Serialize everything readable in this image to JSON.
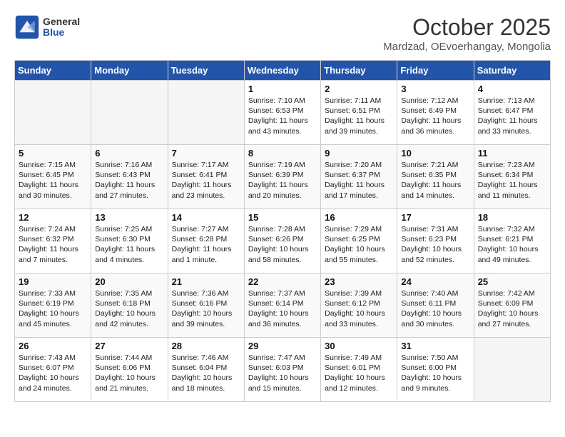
{
  "header": {
    "logo_general": "General",
    "logo_blue": "Blue",
    "month": "October 2025",
    "location": "Mardzad, OEvoerhangay, Mongolia"
  },
  "weekdays": [
    "Sunday",
    "Monday",
    "Tuesday",
    "Wednesday",
    "Thursday",
    "Friday",
    "Saturday"
  ],
  "weeks": [
    [
      {
        "day": "",
        "info": ""
      },
      {
        "day": "",
        "info": ""
      },
      {
        "day": "",
        "info": ""
      },
      {
        "day": "1",
        "info": "Sunrise: 7:10 AM\nSunset: 6:53 PM\nDaylight: 11 hours and 43 minutes."
      },
      {
        "day": "2",
        "info": "Sunrise: 7:11 AM\nSunset: 6:51 PM\nDaylight: 11 hours and 39 minutes."
      },
      {
        "day": "3",
        "info": "Sunrise: 7:12 AM\nSunset: 6:49 PM\nDaylight: 11 hours and 36 minutes."
      },
      {
        "day": "4",
        "info": "Sunrise: 7:13 AM\nSunset: 6:47 PM\nDaylight: 11 hours and 33 minutes."
      }
    ],
    [
      {
        "day": "5",
        "info": "Sunrise: 7:15 AM\nSunset: 6:45 PM\nDaylight: 11 hours and 30 minutes."
      },
      {
        "day": "6",
        "info": "Sunrise: 7:16 AM\nSunset: 6:43 PM\nDaylight: 11 hours and 27 minutes."
      },
      {
        "day": "7",
        "info": "Sunrise: 7:17 AM\nSunset: 6:41 PM\nDaylight: 11 hours and 23 minutes."
      },
      {
        "day": "8",
        "info": "Sunrise: 7:19 AM\nSunset: 6:39 PM\nDaylight: 11 hours and 20 minutes."
      },
      {
        "day": "9",
        "info": "Sunrise: 7:20 AM\nSunset: 6:37 PM\nDaylight: 11 hours and 17 minutes."
      },
      {
        "day": "10",
        "info": "Sunrise: 7:21 AM\nSunset: 6:35 PM\nDaylight: 11 hours and 14 minutes."
      },
      {
        "day": "11",
        "info": "Sunrise: 7:23 AM\nSunset: 6:34 PM\nDaylight: 11 hours and 11 minutes."
      }
    ],
    [
      {
        "day": "12",
        "info": "Sunrise: 7:24 AM\nSunset: 6:32 PM\nDaylight: 11 hours and 7 minutes."
      },
      {
        "day": "13",
        "info": "Sunrise: 7:25 AM\nSunset: 6:30 PM\nDaylight: 11 hours and 4 minutes."
      },
      {
        "day": "14",
        "info": "Sunrise: 7:27 AM\nSunset: 6:28 PM\nDaylight: 11 hours and 1 minute."
      },
      {
        "day": "15",
        "info": "Sunrise: 7:28 AM\nSunset: 6:26 PM\nDaylight: 10 hours and 58 minutes."
      },
      {
        "day": "16",
        "info": "Sunrise: 7:29 AM\nSunset: 6:25 PM\nDaylight: 10 hours and 55 minutes."
      },
      {
        "day": "17",
        "info": "Sunrise: 7:31 AM\nSunset: 6:23 PM\nDaylight: 10 hours and 52 minutes."
      },
      {
        "day": "18",
        "info": "Sunrise: 7:32 AM\nSunset: 6:21 PM\nDaylight: 10 hours and 49 minutes."
      }
    ],
    [
      {
        "day": "19",
        "info": "Sunrise: 7:33 AM\nSunset: 6:19 PM\nDaylight: 10 hours and 45 minutes."
      },
      {
        "day": "20",
        "info": "Sunrise: 7:35 AM\nSunset: 6:18 PM\nDaylight: 10 hours and 42 minutes."
      },
      {
        "day": "21",
        "info": "Sunrise: 7:36 AM\nSunset: 6:16 PM\nDaylight: 10 hours and 39 minutes."
      },
      {
        "day": "22",
        "info": "Sunrise: 7:37 AM\nSunset: 6:14 PM\nDaylight: 10 hours and 36 minutes."
      },
      {
        "day": "23",
        "info": "Sunrise: 7:39 AM\nSunset: 6:12 PM\nDaylight: 10 hours and 33 minutes."
      },
      {
        "day": "24",
        "info": "Sunrise: 7:40 AM\nSunset: 6:11 PM\nDaylight: 10 hours and 30 minutes."
      },
      {
        "day": "25",
        "info": "Sunrise: 7:42 AM\nSunset: 6:09 PM\nDaylight: 10 hours and 27 minutes."
      }
    ],
    [
      {
        "day": "26",
        "info": "Sunrise: 7:43 AM\nSunset: 6:07 PM\nDaylight: 10 hours and 24 minutes."
      },
      {
        "day": "27",
        "info": "Sunrise: 7:44 AM\nSunset: 6:06 PM\nDaylight: 10 hours and 21 minutes."
      },
      {
        "day": "28",
        "info": "Sunrise: 7:46 AM\nSunset: 6:04 PM\nDaylight: 10 hours and 18 minutes."
      },
      {
        "day": "29",
        "info": "Sunrise: 7:47 AM\nSunset: 6:03 PM\nDaylight: 10 hours and 15 minutes."
      },
      {
        "day": "30",
        "info": "Sunrise: 7:49 AM\nSunset: 6:01 PM\nDaylight: 10 hours and 12 minutes."
      },
      {
        "day": "31",
        "info": "Sunrise: 7:50 AM\nSunset: 6:00 PM\nDaylight: 10 hours and 9 minutes."
      },
      {
        "day": "",
        "info": ""
      }
    ]
  ]
}
